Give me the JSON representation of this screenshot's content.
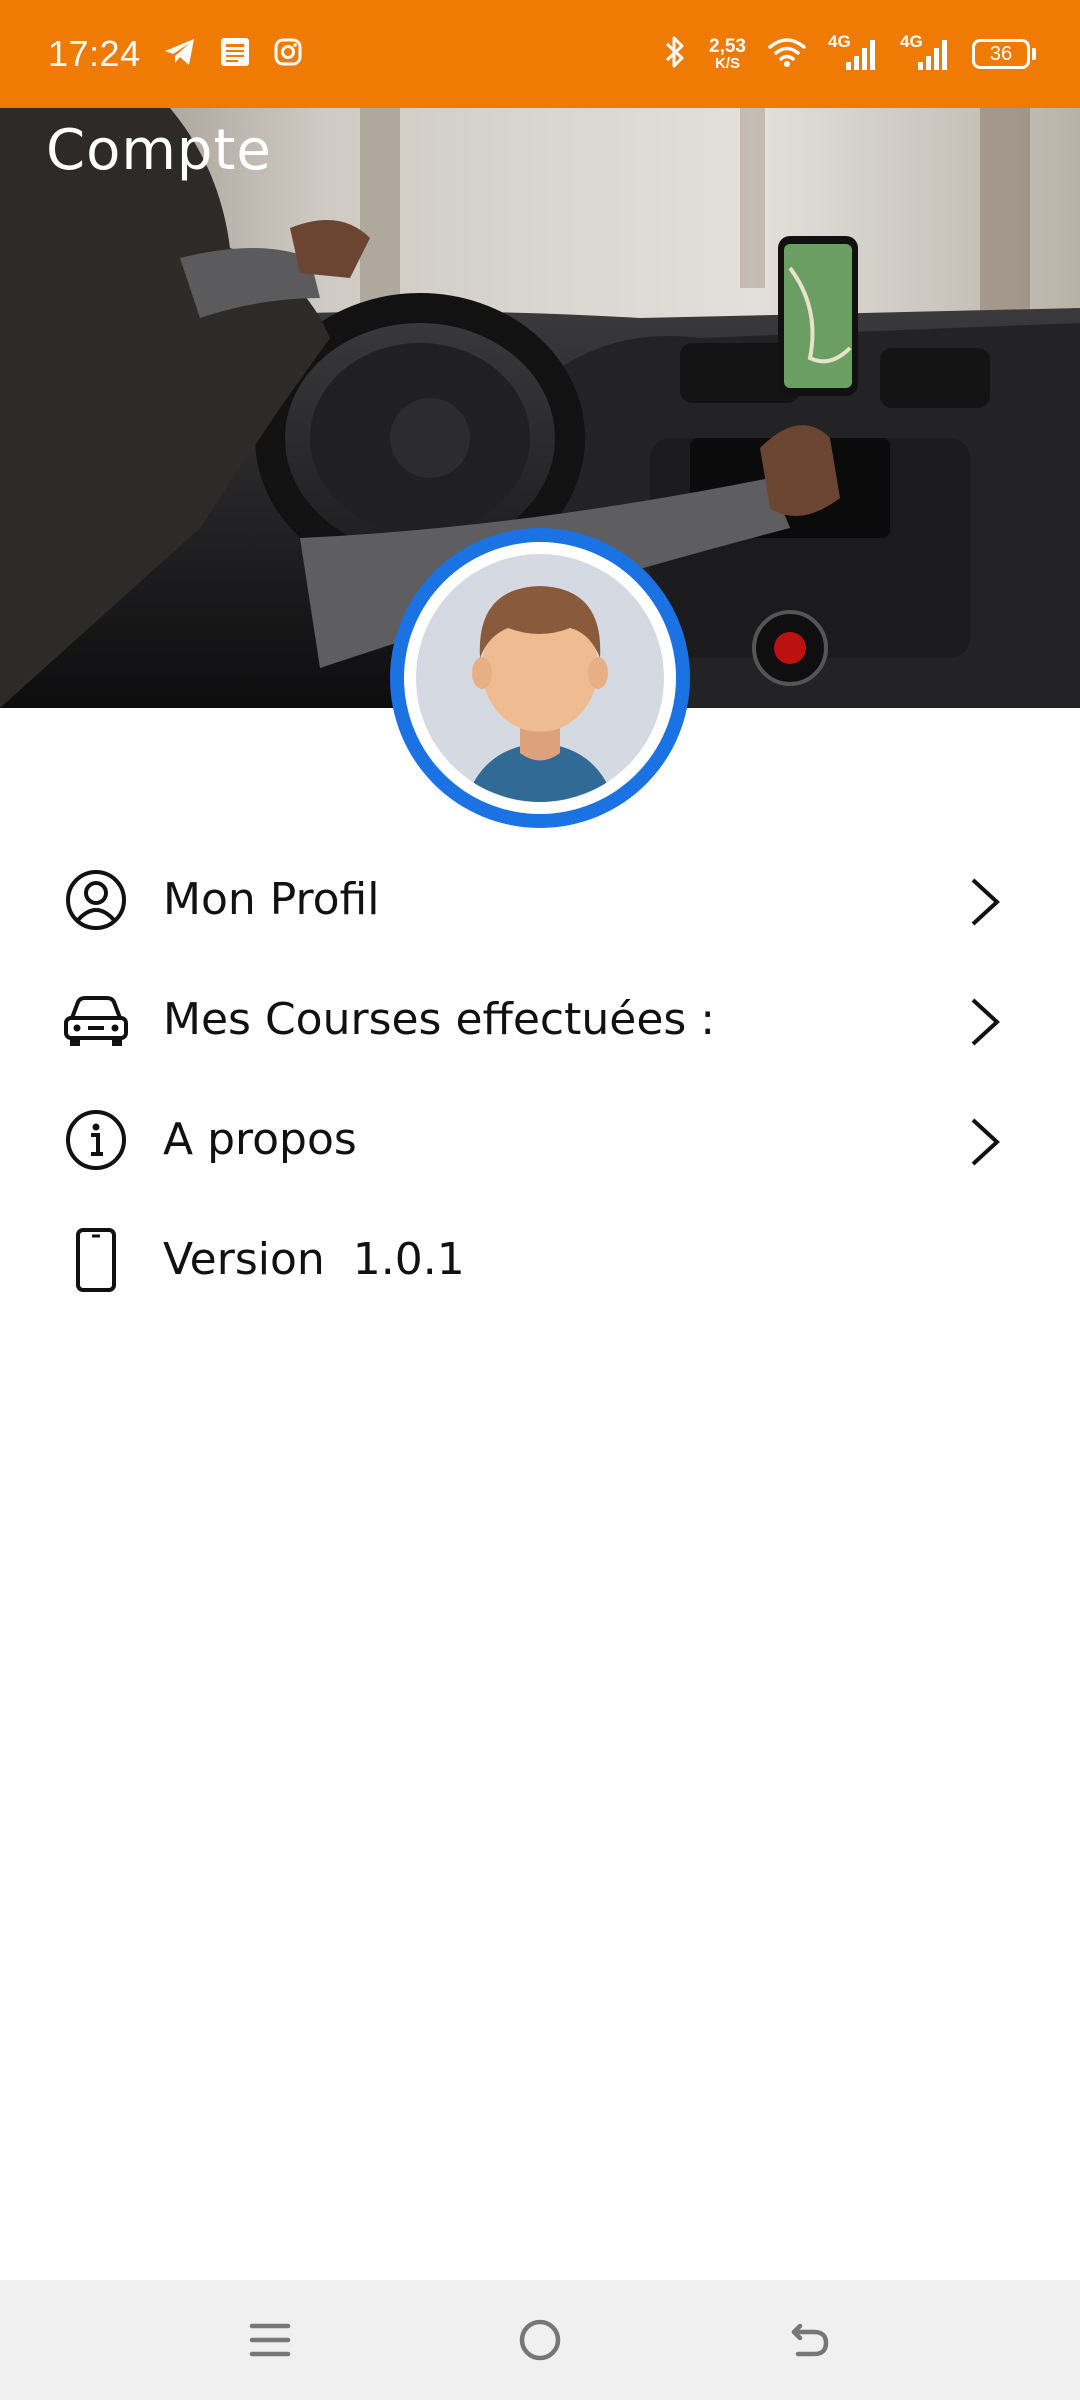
{
  "status_bar": {
    "time": "17:24",
    "speed_value": "2,53",
    "speed_unit": "K/S",
    "network_1": "4G",
    "network_2": "4G",
    "battery": "36",
    "icons": [
      "telegram-icon",
      "news-icon",
      "instagram-icon",
      "bluetooth-icon",
      "wifi-icon",
      "signal-icon",
      "battery-icon"
    ]
  },
  "header": {
    "title": "Compte"
  },
  "menu": {
    "items": [
      {
        "label": "Mon Profil",
        "icon": "user-circle-icon",
        "has_chevron": true
      },
      {
        "label": "Mes Courses effectuées :",
        "icon": "car-icon",
        "has_chevron": true
      },
      {
        "label": "A propos",
        "icon": "info-icon",
        "has_chevron": true
      },
      {
        "label": "Version  1.0.1",
        "icon": "phone-icon",
        "has_chevron": false
      }
    ]
  },
  "nav_bar": {
    "buttons": [
      "menu-icon",
      "home-icon",
      "back-icon"
    ]
  },
  "colors": {
    "status_bar": "#EF7B05",
    "avatar_ring": "#1A72E3",
    "nav_bar": "#F0F0F0"
  }
}
